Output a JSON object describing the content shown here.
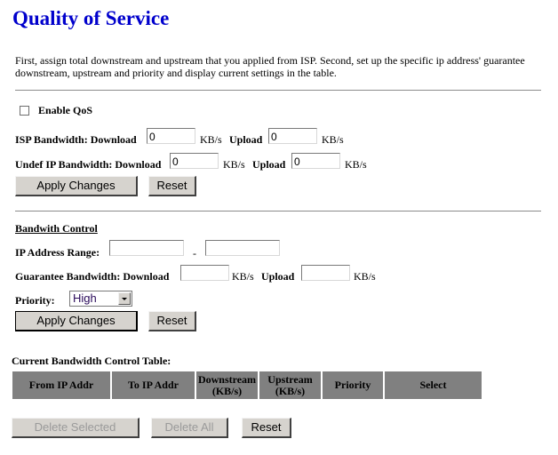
{
  "page": {
    "title": "Quality of Service",
    "description": "First, assign total downstream and upstream that you applied from ISP. Second, set up the specific ip address' guarantee downstream, upstream and priority and display current settings in the table."
  },
  "qos": {
    "enable_label": "Enable QoS",
    "enable_checked": false,
    "isp_label": "ISP Bandwidth: Download",
    "isp_download": "0",
    "isp_upload": "0",
    "undef_label": "Undef IP Bandwidth: Download",
    "undef_download": "0",
    "undef_upload": "0",
    "upload_label": "Upload",
    "unit": "KB/s",
    "apply_label": "Apply Changes",
    "reset_label": "Reset"
  },
  "bandwidth_control": {
    "heading": "Bandwith Control",
    "ip_range_label": "IP Address Range:",
    "ip_from": "",
    "ip_to": "",
    "range_separator": "-",
    "guarantee_label": "Guarantee Bandwidth: Download",
    "guarantee_download": "",
    "guarantee_upload": "",
    "upload_label": "Upload",
    "unit": "KB/s",
    "priority_label": "Priority:",
    "priority_value": "High",
    "apply_label": "Apply Changes",
    "reset_label": "Reset"
  },
  "table": {
    "caption": "Current Bandwidth Control Table:",
    "headers": [
      {
        "line1": "From IP Addr",
        "line2": ""
      },
      {
        "line1": "To IP Addr",
        "line2": ""
      },
      {
        "line1": "Downstream",
        "line2": "(KB/s)"
      },
      {
        "line1": "Upstream",
        "line2": "(KB/s)"
      },
      {
        "line1": "Priority",
        "line2": ""
      },
      {
        "line1": "Select",
        "line2": ""
      }
    ],
    "rows": []
  },
  "table_actions": {
    "delete_selected_label": "Delete Selected",
    "delete_all_label": "Delete All",
    "reset_label": "Reset"
  },
  "colors": {
    "title": "#0000cc",
    "table_header_bg": "#808080",
    "button_bg": "#d6d3ce"
  }
}
